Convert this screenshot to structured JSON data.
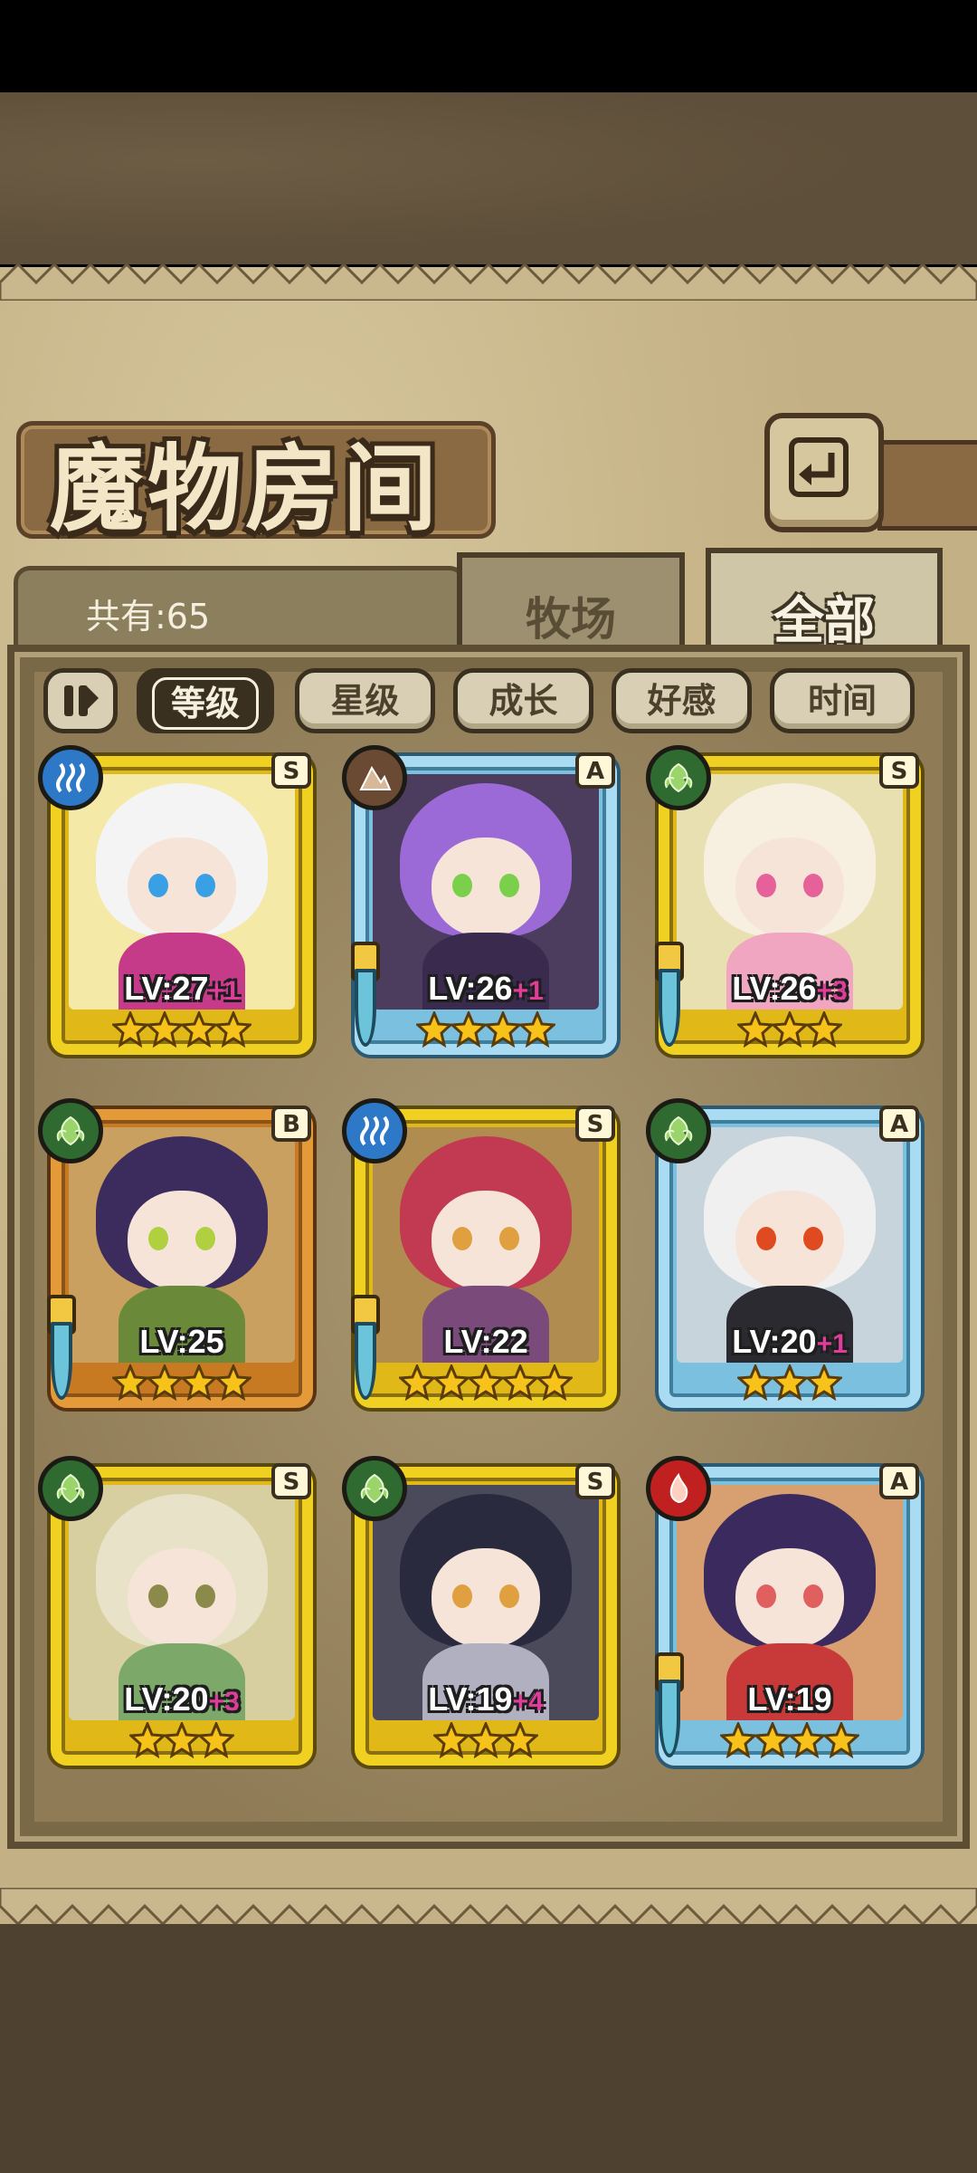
{
  "header": {
    "title": "魔物房间"
  },
  "summary": {
    "count_label": "共有:65"
  },
  "tabs": [
    {
      "label": "牧场",
      "active": false
    },
    {
      "label": "全部",
      "active": true
    }
  ],
  "sort_buttons": [
    {
      "label": "等级",
      "active": true
    },
    {
      "label": "星级",
      "active": false
    },
    {
      "label": "成长",
      "active": false
    },
    {
      "label": "好感",
      "active": false
    },
    {
      "label": "时间",
      "active": false
    }
  ],
  "monsters": [
    {
      "level": "LV:27",
      "bonus": "+1",
      "rank": "S",
      "element": "water-icon",
      "frame": "gold",
      "stars": 4,
      "weapon": false,
      "colors": {
        "hair": "#f4f4f4",
        "body": "#c63a8a",
        "eye": "#3aa0e6",
        "bg": "#f5e9a8"
      }
    },
    {
      "level": "LV:26",
      "bonus": "+1",
      "rank": "A",
      "element": "earth-icon",
      "frame": "blue",
      "stars": 4,
      "weapon": true,
      "colors": {
        "hair": "#9b6ad6",
        "body": "#3a2a4e",
        "eye": "#7ad04a",
        "bg": "#4c3c5e"
      }
    },
    {
      "level": "LV:26",
      "bonus": "+3",
      "rank": "S",
      "element": "nature-icon",
      "frame": "gold",
      "stars": 3,
      "weapon": true,
      "colors": {
        "hair": "#f7efe0",
        "body": "#f0a6c0",
        "eye": "#e6609a",
        "bg": "#e8e0b0"
      }
    },
    {
      "level": "LV:25",
      "bonus": "",
      "rank": "B",
      "element": "nature-icon",
      "frame": "bronze",
      "stars": 4,
      "weapon": true,
      "colors": {
        "hair": "#3c2c5e",
        "body": "#6a8a3a",
        "eye": "#b0d040",
        "bg": "#c9a060"
      }
    },
    {
      "level": "LV:22",
      "bonus": "",
      "rank": "S",
      "element": "water-icon",
      "frame": "gold",
      "stars": 5,
      "weapon": true,
      "colors": {
        "hair": "#c23a52",
        "body": "#7a4a7a",
        "eye": "#e0a040",
        "bg": "#b08c50"
      }
    },
    {
      "level": "LV:20",
      "bonus": "+1",
      "rank": "A",
      "element": "nature-icon",
      "frame": "blue",
      "stars": 3,
      "weapon": false,
      "colors": {
        "hair": "#f0f0f0",
        "body": "#2a2a30",
        "eye": "#e04a20",
        "bg": "#c8d4dc"
      }
    },
    {
      "level": "LV:20",
      "bonus": "+3",
      "rank": "S",
      "element": "nature-icon",
      "frame": "gold",
      "stars": 3,
      "weapon": false,
      "colors": {
        "hair": "#e8e2c8",
        "body": "#7ca86a",
        "eye": "#8c8a4a",
        "bg": "#d8cfa0"
      }
    },
    {
      "level": "LV:19",
      "bonus": "+4",
      "rank": "S",
      "element": "nature-icon",
      "frame": "gold",
      "stars": 3,
      "weapon": false,
      "colors": {
        "hair": "#2a2a3e",
        "body": "#b0b0c0",
        "eye": "#e0a040",
        "bg": "#4a4a5a"
      }
    },
    {
      "level": "LV:19",
      "bonus": "",
      "rank": "A",
      "element": "fire-icon",
      "frame": "blue",
      "stars": 4,
      "weapon": true,
      "colors": {
        "hair": "#3a2a5e",
        "body": "#c83a3a",
        "eye": "#e06060",
        "bg": "#d8a070"
      }
    }
  ]
}
